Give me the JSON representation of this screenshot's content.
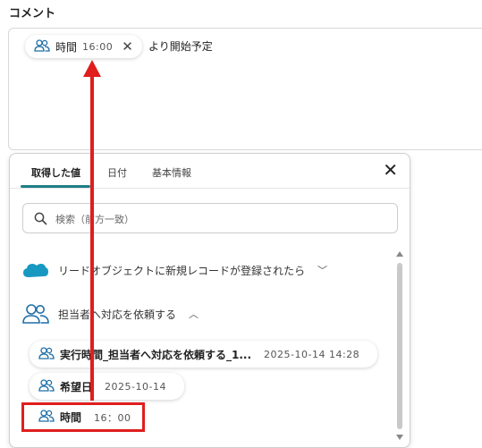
{
  "comment": {
    "label": "コメント",
    "chip": {
      "name": "時間",
      "value": "16:00"
    },
    "rest_text": "より開始予定"
  },
  "panel": {
    "tabs": [
      {
        "label": "取得した値",
        "active": true
      },
      {
        "label": "日付",
        "active": false
      },
      {
        "label": "基本情報",
        "active": false
      }
    ],
    "search": {
      "placeholder": "検索（前方一致）"
    },
    "sections": [
      {
        "label": "リードオブジェクトに新規レコードが登録されたら",
        "icon": "salesforce-cloud-icon",
        "expanded": false
      },
      {
        "label": "担当者へ対応を依頼する",
        "icon": "people-icon",
        "expanded": true
      }
    ],
    "items": [
      {
        "name": "実行時間_担当者へ対応を依頼する_1...",
        "value": "2025-10-14 14:28"
      },
      {
        "name": "希望日",
        "value": "2025-10-14"
      },
      {
        "name": "時間",
        "value": "16：00"
      }
    ]
  },
  "colors": {
    "accent": "#1f7f87",
    "highlight": "#e01e1e",
    "salesforce": "#1798c1",
    "people_icon": "#1f6fa8"
  }
}
